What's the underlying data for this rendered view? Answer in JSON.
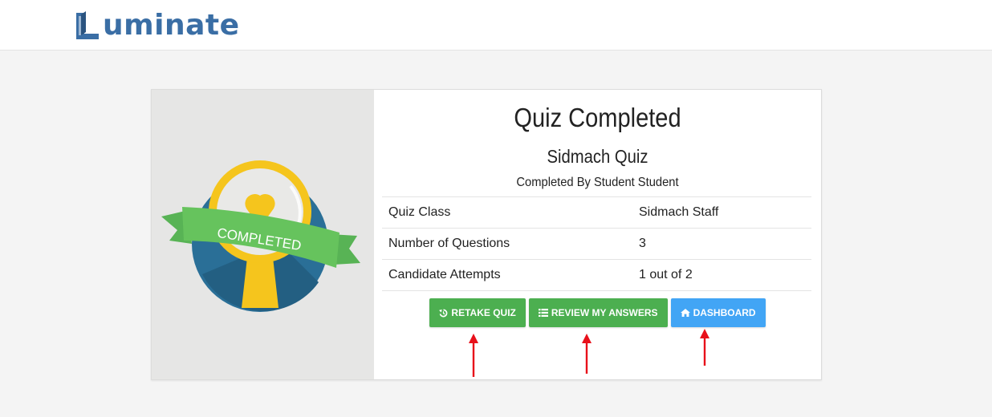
{
  "header": {
    "logo_text": "uminate",
    "logo_alt": "Luminate"
  },
  "badge": {
    "ribbon_text": "COMPLETED"
  },
  "result": {
    "title": "Quiz Completed",
    "quiz_name": "Sidmach Quiz",
    "completed_by": "Completed By Student Student",
    "rows": [
      {
        "label": "Quiz Class",
        "value": "Sidmach Staff"
      },
      {
        "label": "Number of Questions",
        "value": "3"
      },
      {
        "label": "Candidate Attempts",
        "value": "1 out of 2"
      }
    ]
  },
  "actions": {
    "retake": "RETAKE QUIZ",
    "review": "REVIEW MY ANSWERS",
    "dashboard": "DASHBOARD"
  },
  "colors": {
    "green": "#4caf50",
    "blue": "#42a5f5",
    "brand": "#3a6ea5",
    "arrow": "#e8101a"
  }
}
